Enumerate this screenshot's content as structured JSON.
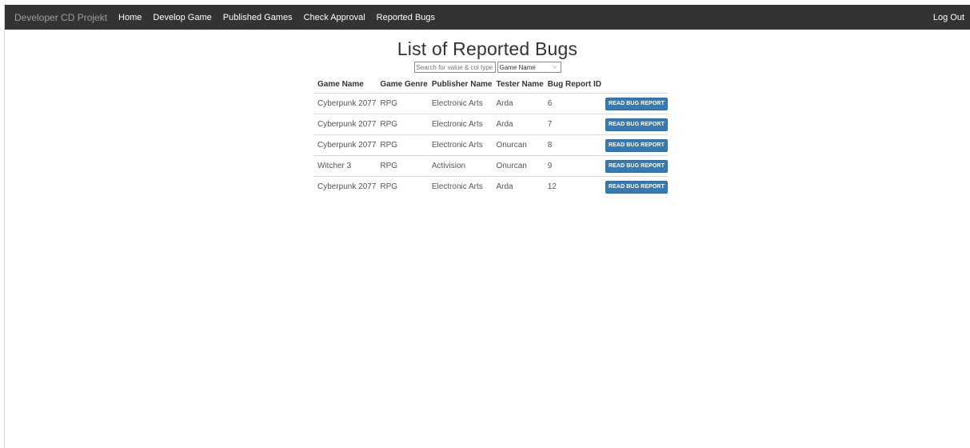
{
  "navbar": {
    "brand": "Developer CD Projekt",
    "links": [
      "Home",
      "Develop Game",
      "Published Games",
      "Check Approval",
      "Reported Bugs"
    ],
    "logout": "Log Out"
  },
  "page": {
    "title": "List of Reported Bugs"
  },
  "search": {
    "placeholder": "Search for value & col type",
    "type_value": "Game Name"
  },
  "table": {
    "headers": [
      "Game Name",
      "Game Genre",
      "Publisher Name",
      "Tester Name",
      "Bug Report ID"
    ],
    "button_label": "READ BUG REPORT",
    "rows": [
      {
        "game": "Cyberpunk 2077",
        "genre": "RPG",
        "publisher": "Electronic Arts",
        "tester": "Arda",
        "id": "6"
      },
      {
        "game": "Cyberpunk 2077",
        "genre": "RPG",
        "publisher": "Electronic Arts",
        "tester": "Arda",
        "id": "7"
      },
      {
        "game": "Cyberpunk 2077",
        "genre": "RPG",
        "publisher": "Electronic Arts",
        "tester": "Onurcan",
        "id": "8"
      },
      {
        "game": "Witcher 3",
        "genre": "RPG",
        "publisher": "Activision",
        "tester": "Onurcan",
        "id": "9"
      },
      {
        "game": "Cyberpunk 2077",
        "genre": "RPG",
        "publisher": "Electronic Arts",
        "tester": "Arda",
        "id": "12"
      }
    ]
  },
  "colors": {
    "navbar_bg": "#333333",
    "brand_text": "#9d9d9d",
    "button_primary": "#337ab7"
  }
}
